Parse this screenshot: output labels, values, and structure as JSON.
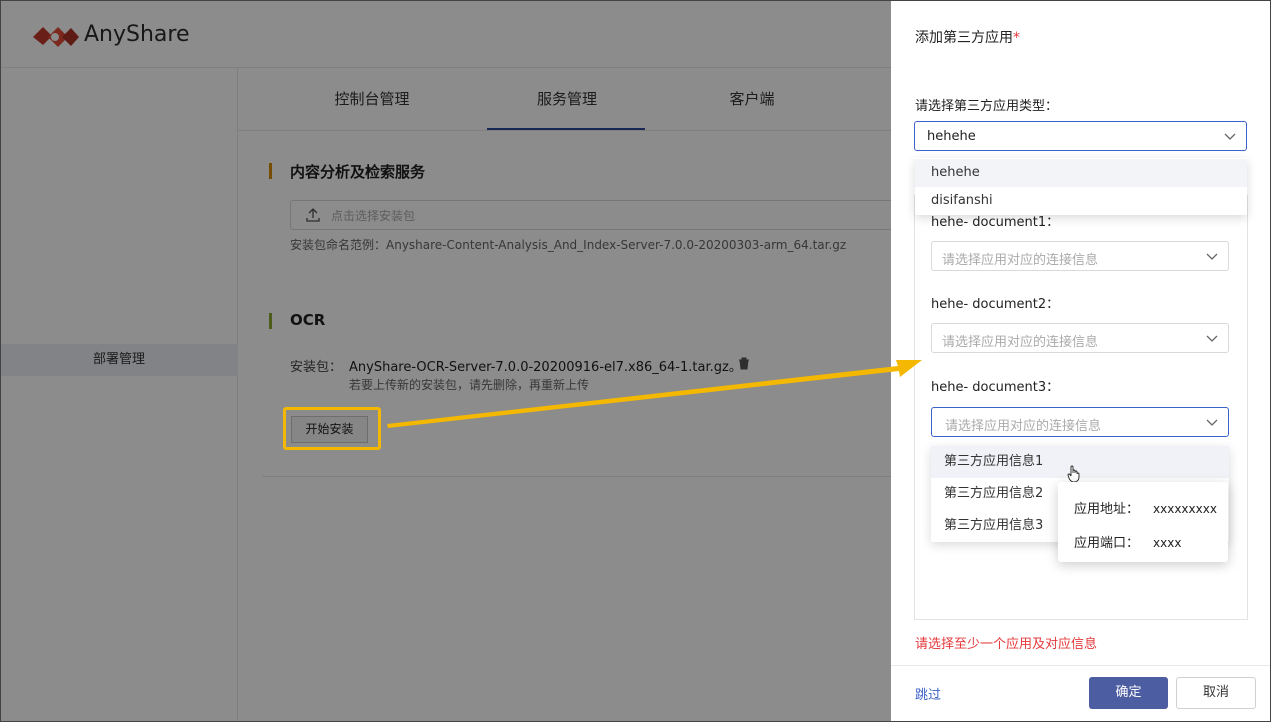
{
  "colors": {
    "accent": "#4c5da1",
    "highlight": "#f5b800",
    "error": "#e5383b",
    "link": "#3b62c8"
  },
  "app": {
    "brand": "AnyShare",
    "sidebar": {
      "active_item": "部署管理"
    },
    "tabs": [
      {
        "label": "控制台管理",
        "active": false
      },
      {
        "label": "服务管理",
        "active": true
      },
      {
        "label": "客户端",
        "active": false
      }
    ],
    "section1": {
      "title": "内容分析及检索服务",
      "upload_placeholder": "点击选择安装包",
      "naming_hint": "安装包命名范例：Anyshare-Content-Analysis_And_Index-Server-7.0.0-20200303-arm_64.tar.gz"
    },
    "section2": {
      "title": "OCR",
      "package_label": "安装包：",
      "package_file": "AnyShare-OCR-Server-7.0.0-20200916-el7.x86_64-1.tar.gz。",
      "reupload_hint": "若要上传新的安装包，请先删除，再重新上传",
      "install_button": "开始安装"
    }
  },
  "drawer": {
    "title": "添加第三方应用",
    "required_mark": "*",
    "type_label": "请选择第三方应用类型：",
    "type_value": "hehehe",
    "type_options": [
      "hehehe",
      "disifanshi"
    ],
    "documents": [
      {
        "label": "hehe- document1：",
        "placeholder": "请选择应用对应的连接信息"
      },
      {
        "label": "hehe- document2：",
        "placeholder": "请选择应用对应的连接信息"
      },
      {
        "label": "hehe- document3：",
        "placeholder": "请选择应用对应的连接信息"
      }
    ],
    "info_options": [
      "第三方应用信息1",
      "第三方应用信息2",
      "第三方应用信息3"
    ],
    "tooltip": {
      "addr_label": "应用地址：",
      "addr_value": "xxxxxxxxx",
      "port_label": "应用端口：",
      "port_value": "xxxx"
    },
    "error": "请选择至少一个应用及对应信息",
    "skip": "跳过",
    "ok": "确定",
    "cancel": "取消"
  }
}
